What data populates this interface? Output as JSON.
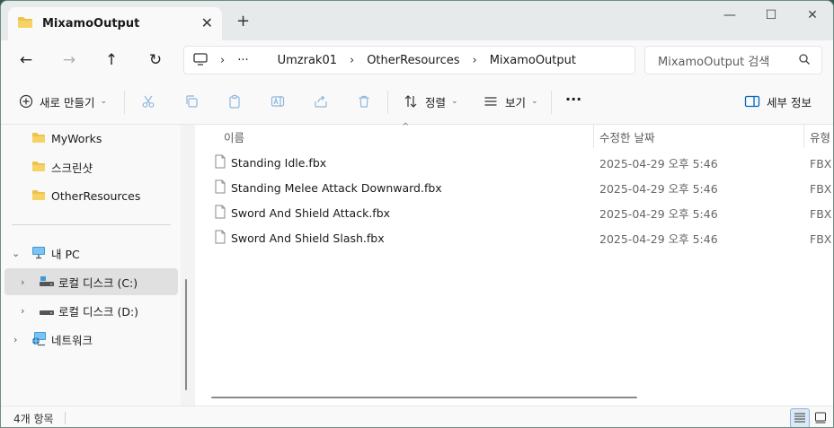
{
  "window": {
    "tab_title": "MixamoOutput",
    "tab_close": "✕",
    "new_tab": "+",
    "minimize": "—",
    "maximize": "☐",
    "close": "✕"
  },
  "nav": {
    "back": "←",
    "forward": "→",
    "up": "↑",
    "refresh": "↻",
    "breadcrumb_more": "···",
    "breadcrumbs": [
      "Umzrak01",
      "OtherResources",
      "MixamoOutput"
    ],
    "search_placeholder": "MixamoOutput 검색"
  },
  "toolbar": {
    "new_label": "새로 만들기",
    "sort_label": "정렬",
    "view_label": "보기",
    "more": "···",
    "details_label": "세부 정보",
    "icons": [
      "cut-icon",
      "copy-icon",
      "paste-icon",
      "rename-icon",
      "share-icon",
      "delete-icon"
    ]
  },
  "sidebar": {
    "folders": [
      {
        "label": "MyWorks"
      },
      {
        "label": "스크린샷"
      },
      {
        "label": "OtherResources"
      }
    ],
    "this_pc": "내 PC",
    "drives": [
      {
        "label": "로컬 디스크 (C:)",
        "selected": true
      },
      {
        "label": "로컬 디스크 (D:)",
        "selected": false
      }
    ],
    "network": "네트워크"
  },
  "content": {
    "columns": {
      "name": "이름",
      "date": "수정한 날짜",
      "type": "유형"
    },
    "files": [
      {
        "name": "Standing Idle.fbx",
        "date": "2025-04-29 오후 5:46",
        "type": "FBX 파일"
      },
      {
        "name": "Standing Melee Attack Downward.fbx",
        "date": "2025-04-29 오후 5:46",
        "type": "FBX 파일"
      },
      {
        "name": "Sword And Shield Attack.fbx",
        "date": "2025-04-29 오후 5:46",
        "type": "FBX 파일"
      },
      {
        "name": "Sword And Shield Slash.fbx",
        "date": "2025-04-29 오후 5:46",
        "type": "FBX 파일"
      }
    ]
  },
  "status": {
    "item_count": "4개 항목"
  },
  "colors": {
    "folder": "#f0c14b",
    "accent": "#0067c0",
    "selected_bg": "#e0e0e0"
  }
}
